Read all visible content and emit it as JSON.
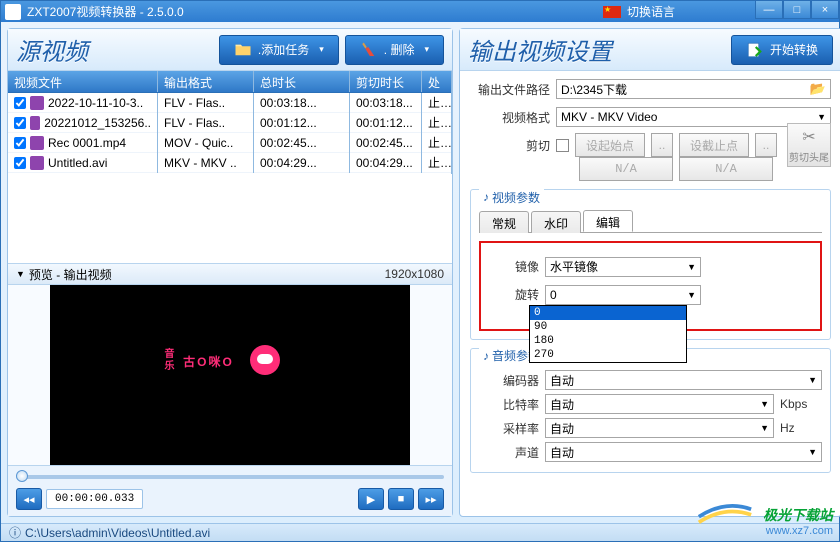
{
  "titlebar": {
    "title": "ZXT2007视频转换器 - 2.5.0.0",
    "switch_lang": "切换语言"
  },
  "left": {
    "title": "源视频",
    "add_task": ".添加任务",
    "delete": ". 删除",
    "cols": {
      "file": "视频文件",
      "outfmt": "输出格式",
      "total": "总时长",
      "cut": "剪切时长",
      "proc": "处"
    },
    "rows": [
      {
        "file": "2022-10-11-10-3..",
        "fmt": "FLV - Flas..",
        "dur": "00:03:18...",
        "cut": "00:03:18...",
        "p": "止.."
      },
      {
        "file": "20221012_153256..",
        "fmt": "FLV - Flas..",
        "dur": "00:01:12...",
        "cut": "00:01:12...",
        "p": "止.."
      },
      {
        "file": "Rec 0001.mp4",
        "fmt": "MOV - Quic..",
        "dur": "00:02:45...",
        "cut": "00:02:45...",
        "p": "止.."
      },
      {
        "file": "Untitled.avi",
        "fmt": "MKV - MKV ..",
        "dur": "00:04:29...",
        "cut": "00:04:29...",
        "p": "止.."
      }
    ],
    "preview_label": "预览 - 输出视频",
    "preview_dim": "1920x1080",
    "logo_text": "古O咪O",
    "logo_sub": "音乐",
    "timecode": "00:00:00.033"
  },
  "right": {
    "title": "输出视频设置",
    "start": "开始转换",
    "rows": {
      "outpath_lbl": "输出文件路径",
      "outpath_val": "D:\\2345下载",
      "vfmt_lbl": "视频格式",
      "vfmt_val": "MKV - MKV Video",
      "cut_lbl": "剪切",
      "set_start": "设起始点",
      "set_end": "设截止点",
      "na": "N/A",
      "trim": "剪切头尾",
      "dots": ".."
    },
    "video_params_legend": "视频参数",
    "tabs": {
      "general": "常规",
      "watermark": "水印",
      "edit": "编辑"
    },
    "mirror_lbl": "镜像",
    "mirror_val": "水平镜像",
    "rotate_lbl": "旋转",
    "rotate_val": "0",
    "rotate_opts": [
      "0",
      "90",
      "180",
      "270"
    ],
    "audio_params_legend": "音频参数",
    "audio": {
      "encoder_lbl": "编码器",
      "encoder_val": "自动",
      "bitrate_lbl": "比特率",
      "bitrate_val": "自动",
      "bitrate_unit": "Kbps",
      "samplerate_lbl": "采样率",
      "samplerate_val": "自动",
      "samplerate_unit": "Hz",
      "channels_lbl": "声道",
      "channels_val": "自动"
    }
  },
  "status": {
    "path": "C:\\Users\\admin\\Videos\\Untitled.avi"
  },
  "watermark": {
    "brand": "极光下载站",
    "url": "www.xz7.com"
  }
}
